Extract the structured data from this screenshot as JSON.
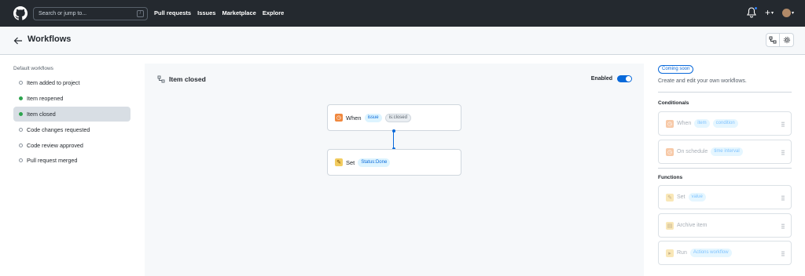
{
  "header": {
    "search_placeholder": "Search or jump to...",
    "search_shortcut": "/",
    "nav": [
      "Pull requests",
      "Issues",
      "Marketplace",
      "Explore"
    ],
    "plus_label": "+"
  },
  "page": {
    "title": "Workflows"
  },
  "sidebar": {
    "heading": "Default workflows",
    "items": [
      {
        "label": "Item added to project",
        "enabled": false,
        "active": false
      },
      {
        "label": "Item reopened",
        "enabled": true,
        "active": false
      },
      {
        "label": "Item closed",
        "enabled": true,
        "active": true
      },
      {
        "label": "Code changes requested",
        "enabled": false,
        "active": false
      },
      {
        "label": "Code review approved",
        "enabled": false,
        "active": false
      },
      {
        "label": "Pull request merged",
        "enabled": false,
        "active": false
      }
    ]
  },
  "canvas": {
    "title": "Item closed",
    "enabled_label": "Enabled",
    "enabled": true,
    "when_node": {
      "label": "When",
      "chip1": "issue",
      "chip2": "is:closed"
    },
    "set_node": {
      "label": "Set",
      "chip": "Status:Done"
    }
  },
  "right_panel": {
    "badge": "Coming soon",
    "description": "Create and edit your own workflows.",
    "conditions_heading": "Conditionals",
    "conditions": [
      {
        "label": "When",
        "chip1": "item",
        "chip2": "condition"
      },
      {
        "label": "On schedule",
        "chip1": "time interval"
      }
    ],
    "functions_heading": "Functions",
    "functions": [
      {
        "label": "Set",
        "chip1": "value"
      },
      {
        "label": "Archive item"
      },
      {
        "label": "Run",
        "chip1": "Actions workflow"
      }
    ]
  },
  "colors": {
    "header_bg": "#24292f",
    "accent": "#0969da",
    "enabled_dot": "#2da44e"
  }
}
